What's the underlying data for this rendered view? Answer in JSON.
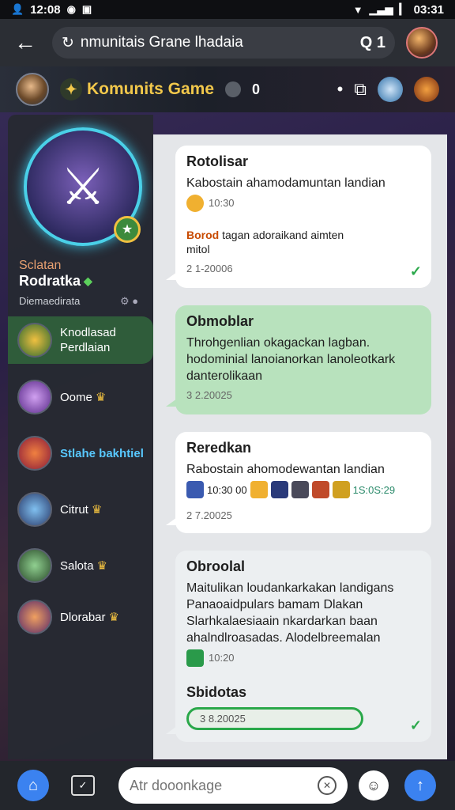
{
  "status_bar": {
    "time_left": "12:08",
    "time_right": "03:31"
  },
  "app_bar": {
    "title": "nmunitais Grane lhadaia",
    "badge": "Q 1"
  },
  "banner": {
    "title": "Komunits Game",
    "count": "0"
  },
  "sidebar": {
    "hero_line1": "Sclatan",
    "hero_line2": "Rodratka",
    "hero_line3": "Diemaedirata",
    "items": [
      {
        "label": "Knodlasad Perdlaian"
      },
      {
        "label": "Oome"
      },
      {
        "label": "Stlahe bakhtiel"
      },
      {
        "label": "Citrut"
      },
      {
        "label": "Salota"
      },
      {
        "label": "Dlorabar"
      }
    ]
  },
  "messages": [
    {
      "title": "Rotolisar",
      "body": "Kabostain ahamodamuntan landian",
      "time": "10:30",
      "extra_bold": "Borod",
      "extra": "tagan adoraikand aimten",
      "extra2": "mitol",
      "date": "2 1-20006"
    },
    {
      "title": "Obmoblar",
      "body": "Throhgenlian okagackan lagban. hodominial lanoianorkan lanoleotkark danterolikaan",
      "date": "3 2.20025"
    },
    {
      "title": "Reredkan",
      "body": "Rabostain ahomodewantan landian",
      "sticker_text_left": "10:30 00",
      "sticker_text_right": "1S:0S:29",
      "date": "2 7.20025"
    },
    {
      "title": "Obroolal",
      "body": "Maitulikan loudankarkakan landigans Panaoaidpulars bamam Dlakan Slarhkalaesiaain nkardarkan baan ahalndlroasadas. Alodelbreemalan",
      "time": "10:20",
      "footer_title": "Sbidotas",
      "date": "3 8.20025"
    }
  ],
  "input": {
    "placeholder": "Atr dooonkage"
  },
  "colors": {
    "accent": "#3b82f0",
    "green": "#2aa84a",
    "bubble_green": "#b8e2bd",
    "banner_title": "#f2c84b"
  }
}
